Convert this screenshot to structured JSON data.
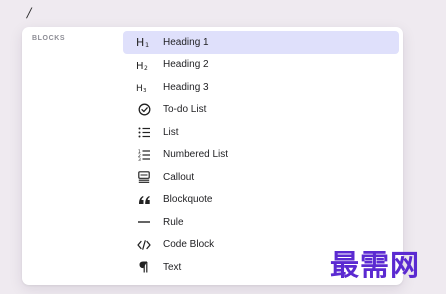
{
  "editor": {
    "caret_char": "/"
  },
  "menu": {
    "section_label": "BLOCKS",
    "items": [
      {
        "icon": "heading1-icon",
        "icon_text": "H1",
        "label": "Heading 1",
        "selected": true
      },
      {
        "icon": "heading2-icon",
        "icon_text": "H2",
        "label": "Heading 2",
        "selected": false
      },
      {
        "icon": "heading3-icon",
        "icon_text": "H3",
        "label": "Heading 3",
        "selected": false
      },
      {
        "icon": "check-circle-icon",
        "label": "To-do List",
        "selected": false
      },
      {
        "icon": "bullet-list-icon",
        "label": "List",
        "selected": false
      },
      {
        "icon": "numbered-list-icon",
        "label": "Numbered List",
        "selected": false
      },
      {
        "icon": "callout-icon",
        "label": "Callout",
        "selected": false
      },
      {
        "icon": "quote-icon",
        "label": "Blockquote",
        "selected": false
      },
      {
        "icon": "rule-icon",
        "label": "Rule",
        "selected": false
      },
      {
        "icon": "code-icon",
        "label": "Code Block",
        "selected": false
      },
      {
        "icon": "pilcrow-icon",
        "label": "Text",
        "selected": false
      }
    ]
  },
  "watermark": {
    "text": "最需网"
  },
  "colors": {
    "background": "#efeaf0",
    "panel": "#ffffff",
    "selected": "#dfe0fb",
    "watermark": "#5b2ad1"
  }
}
